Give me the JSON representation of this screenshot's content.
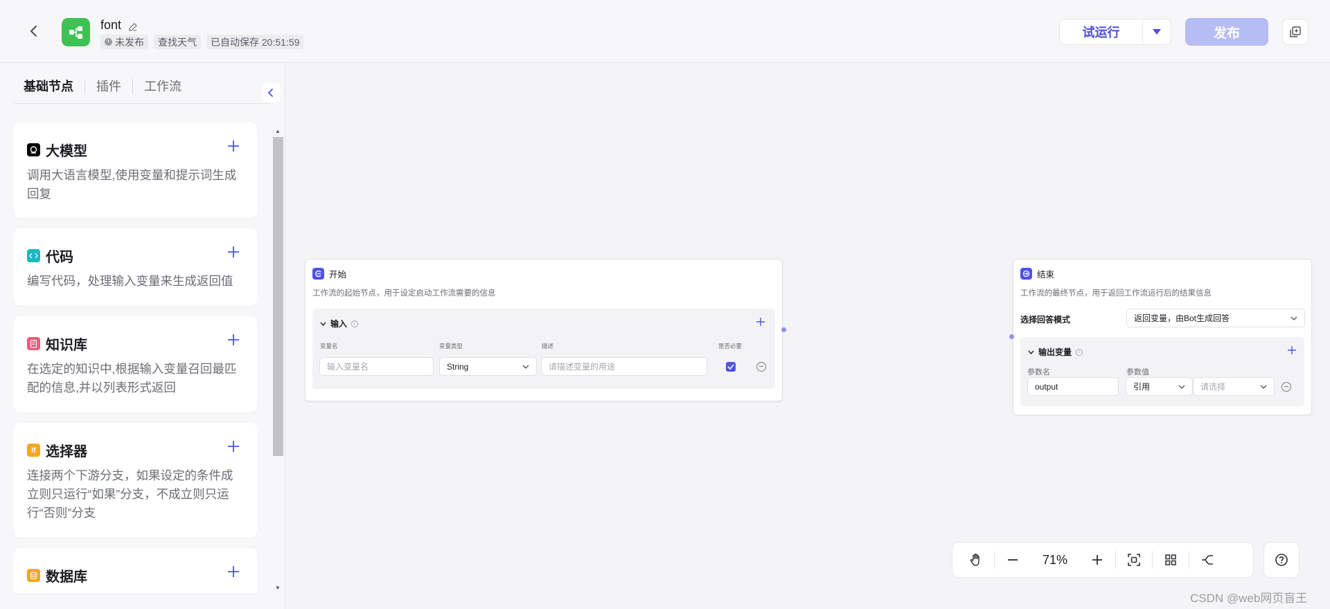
{
  "header": {
    "app_name": "font",
    "tags": [
      "未发布",
      "查找天气",
      "已自动保存 20:51:59"
    ],
    "run_label": "试运行",
    "publish_label": "发布"
  },
  "sidebar": {
    "tabs": [
      "基础节点",
      "插件",
      "工作流"
    ],
    "nodes": [
      {
        "name": "大模型",
        "desc": "调用大语言模型,使用变量和提示词生成回复",
        "icon": "llm-icon",
        "color": "#000000"
      },
      {
        "name": "代码",
        "desc": "编写代码，处理输入变量来生成返回值",
        "icon": "code-icon",
        "color": "#19b8c2"
      },
      {
        "name": "知识库",
        "desc": "在选定的知识中,根据输入变量召回最匹配的信息,并以列表形式返回",
        "icon": "knowledge-icon",
        "color": "#f1597c"
      },
      {
        "name": "选择器",
        "desc": "连接两个下游分支，如果设定的条件成立则只运行“如果”分支，不成立则只运行“否则”分支",
        "icon": "condition-icon",
        "color": "#f5a623"
      },
      {
        "name": "数据库",
        "desc": "",
        "icon": "database-icon",
        "color": "#f5a623"
      }
    ]
  },
  "start_node": {
    "title": "开始",
    "desc": "工作流的起始节点，用于设定启动工作流需要的信息",
    "section_title": "输入",
    "col_headers": [
      "变量名",
      "变量类型",
      "描述",
      "是否必要"
    ],
    "var_name_placeholder": "输入变量名",
    "var_type": "String",
    "var_desc_placeholder": "请描述变量的用途"
  },
  "end_node": {
    "title": "结束",
    "desc": "工作流的最终节点，用于返回工作流运行后的结果信息",
    "mode_label": "选择回答模式",
    "mode_value": "返回变量，由Bot生成回答",
    "section_title": "输出变量",
    "col_headers": [
      "参数名",
      "参数值"
    ],
    "param_name": "output",
    "param_type": "引用",
    "param_value_placeholder": "请选择"
  },
  "toolbar": {
    "zoom": "71%"
  },
  "watermark": "CSDN @web网页盲王",
  "colors": {
    "accent": "#4d53e8",
    "publish_disabled": "#b6bcf5",
    "app_icon": "#3ec254"
  }
}
